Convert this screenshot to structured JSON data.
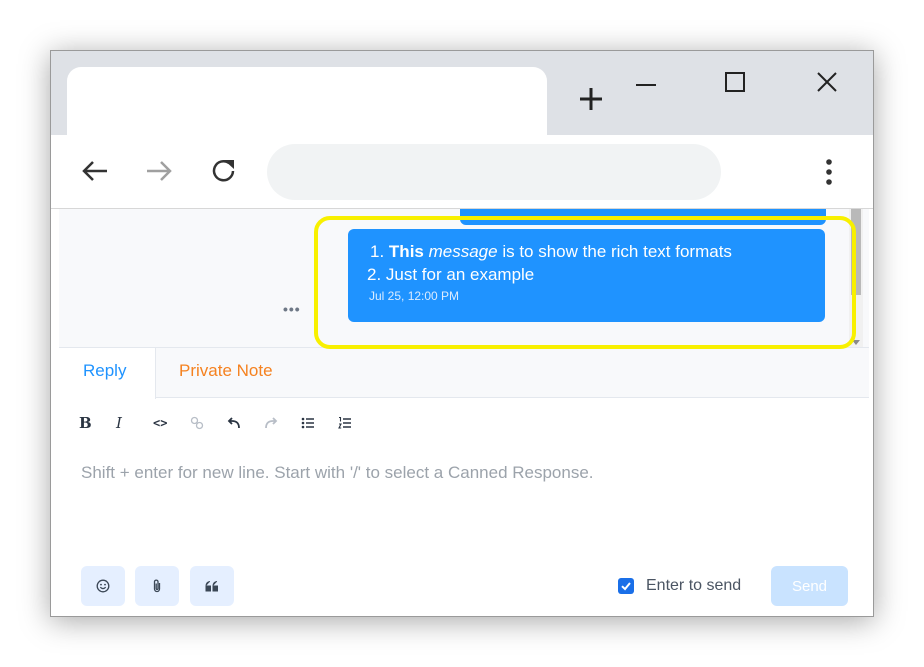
{
  "browser": {
    "tab_title": "",
    "new_tab_icon": "plus-icon",
    "window_controls": [
      "minimize-icon",
      "maximize-icon",
      "close-icon"
    ],
    "nav": [
      "back-arrow-icon",
      "forward-arrow-icon",
      "reload-icon"
    ],
    "address_value": "",
    "menu_icon": "kebab-menu-icon"
  },
  "conversation": {
    "message": {
      "item1_number": "1.",
      "item1_bold": "This",
      "item1_italic": "message",
      "item1_rest": "is to show the rich text formats",
      "item2": "2. Just for an example",
      "timestamp": "Jul 25, 12:00 PM"
    },
    "more_icon": "ellipsis-icon",
    "highlight_color": "#f8f000",
    "bubble_color": "#1f93ff"
  },
  "reply_box": {
    "tabs": [
      {
        "label": "Reply",
        "active": true,
        "color": "#1f93ff"
      },
      {
        "label": "Private Note",
        "active": false,
        "color": "#f58220"
      }
    ],
    "format_tools": [
      {
        "label": "B",
        "icon": "bold-icon"
      },
      {
        "label": "I",
        "icon": "italic-icon"
      },
      {
        "label": "<>",
        "icon": "code-icon"
      },
      {
        "label": "",
        "icon": "link-icon",
        "disabled": true
      },
      {
        "label": "",
        "icon": "undo-icon"
      },
      {
        "label": "",
        "icon": "redo-icon",
        "disabled": true
      },
      {
        "label": "",
        "icon": "bullet-list-icon"
      },
      {
        "label": "",
        "icon": "numbered-list-icon"
      }
    ],
    "placeholder": "Shift + enter for new line. Start with '/' to select a Canned Response.",
    "actions": [
      "emoji-icon",
      "attachment-icon",
      "quote-icon"
    ],
    "enter_to_send_label": "Enter to send",
    "enter_to_send_checked": true,
    "send_label": "Send"
  }
}
